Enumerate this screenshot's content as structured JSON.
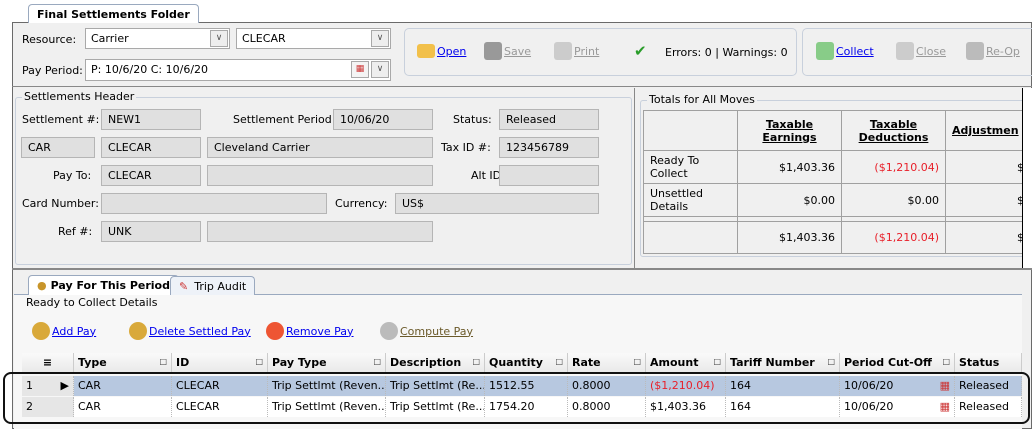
{
  "folder_tab": "Final Settlements Folder",
  "resource": {
    "label": "Resource:",
    "type": "Carrier",
    "id": "CLECAR"
  },
  "pay_period": {
    "label": "Pay Period:",
    "value": "P: 10/6/20     C: 10/6/20"
  },
  "toolbar": {
    "open": "Open",
    "save": "Save",
    "print": "Print",
    "status": "Errors: 0 | Warnings: 0",
    "collect": "Collect",
    "close": "Close",
    "reopen": "Re-Op"
  },
  "header": {
    "title": "Settlements Header",
    "settlement_label": "Settlement #:",
    "settlement": "NEW1",
    "period_label": "Settlement Period:",
    "period": "10/06/20",
    "status_label": "Status:",
    "status": "Released",
    "res_type": "CAR",
    "res_id": "CLECAR",
    "res_name": "Cleveland Carrier",
    "taxid_label": "Tax ID #:",
    "taxid": "123456789",
    "payto_label": "Pay To:",
    "payto": "CLECAR",
    "altid_label": "Alt ID:",
    "card_label": "Card Number:",
    "currency_label": "Currency:",
    "currency": "US$",
    "ref_label": "Ref #:",
    "ref": "UNK"
  },
  "totals": {
    "title": "Totals for All Moves",
    "columns": [
      "Taxable Earnings",
      "Taxable Deductions",
      "Adjustmen"
    ],
    "rows": [
      {
        "label": "Ready To Collect",
        "earn": "$1,403.36",
        "ded": "($1,210.04)",
        "adj": "$"
      },
      {
        "label": "Unsettled Details",
        "earn": "$0.00",
        "ded": "$0.00",
        "adj": "$"
      },
      {
        "label": "",
        "earn": "$1,403.36",
        "ded": "($1,210.04)",
        "adj": "$"
      }
    ]
  },
  "tabs": [
    "Pay For This Period",
    "Trip Audit"
  ],
  "details": {
    "title": "Ready to Collect Details",
    "add": "Add Pay",
    "delete": "Delete Settled Pay",
    "remove": "Remove Pay",
    "compute": "Compute Pay"
  },
  "grid": {
    "columns": [
      "Type",
      "ID",
      "Pay Type",
      "Description",
      "Quantity",
      "Rate",
      "Amount",
      "Tariff Number",
      "Period Cut-Off",
      "Status"
    ],
    "rows": [
      {
        "n": "1",
        "type": "CAR",
        "id": "CLECAR",
        "paytype": "Trip Settlmt (Reven...",
        "desc": "Trip Settlmt (Re...",
        "qty": "1512.55",
        "rate": "0.8000",
        "amount": "($1,210.04)",
        "tariff": "164",
        "cutoff": "10/06/20",
        "status": "Released"
      },
      {
        "n": "2",
        "type": "CAR",
        "id": "CLECAR",
        "paytype": "Trip Settlmt (Reven...",
        "desc": "Trip Settlmt (Re...",
        "qty": "1754.20",
        "rate": "0.8000",
        "amount": "$1,403.36",
        "tariff": "164",
        "cutoff": "10/06/20",
        "status": "Released"
      }
    ]
  }
}
